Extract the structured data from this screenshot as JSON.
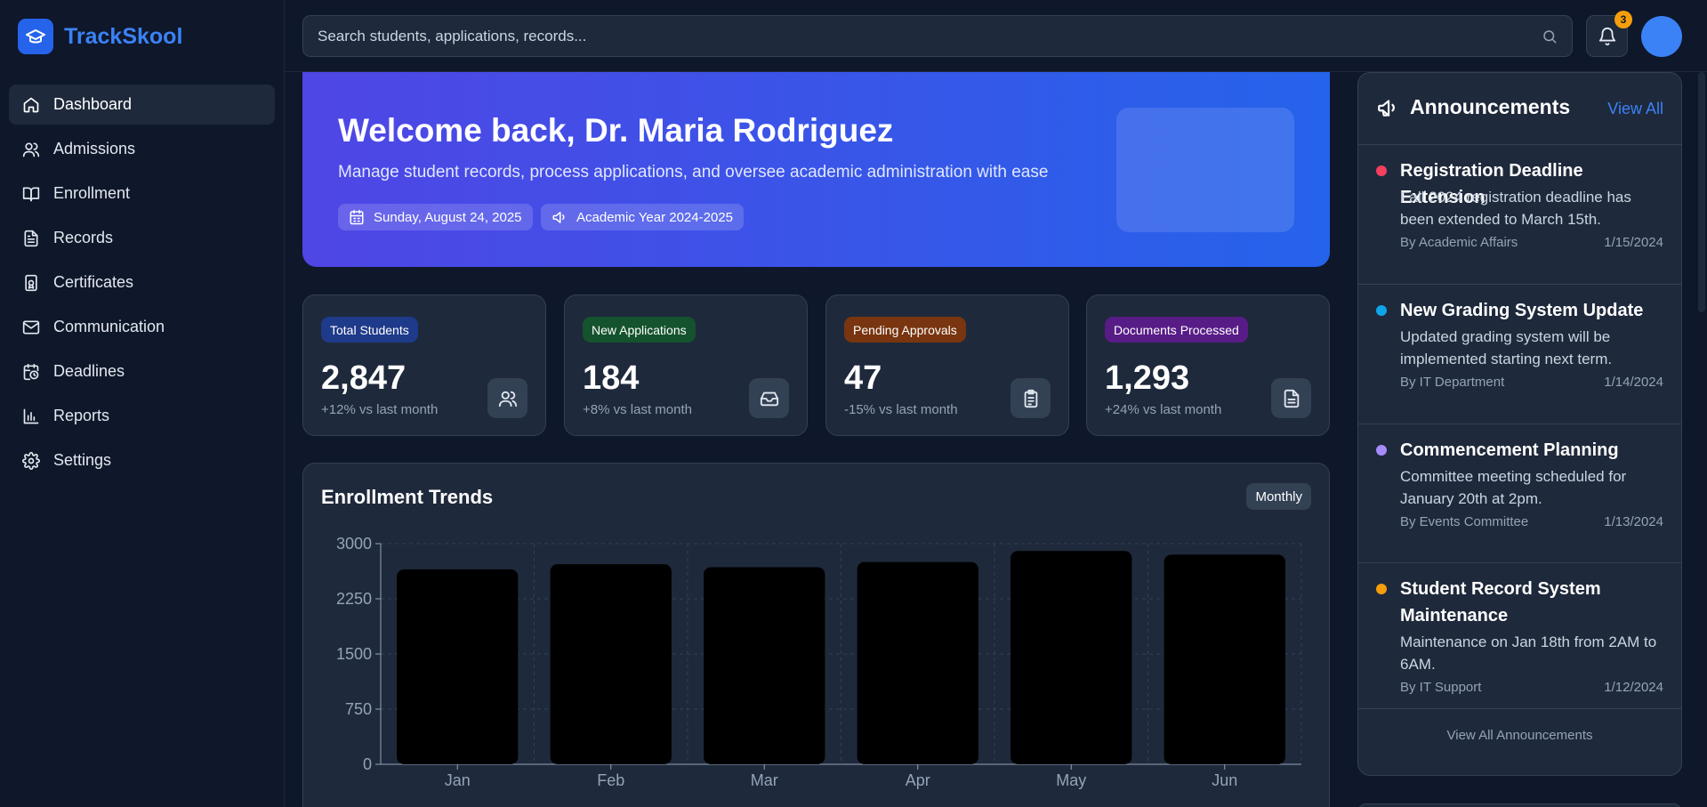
{
  "app": {
    "name": "TrackSkool"
  },
  "sidebar": {
    "items": [
      {
        "label": "Dashboard",
        "icon": "home-icon"
      },
      {
        "label": "Admissions",
        "icon": "users-icon"
      },
      {
        "label": "Enrollment",
        "icon": "book-open-icon"
      },
      {
        "label": "Records",
        "icon": "file-text-icon"
      },
      {
        "label": "Certificates",
        "icon": "certificate-icon"
      },
      {
        "label": "Communication",
        "icon": "mail-icon"
      },
      {
        "label": "Deadlines",
        "icon": "calendar-clock-icon"
      },
      {
        "label": "Reports",
        "icon": "bar-chart-icon"
      },
      {
        "label": "Settings",
        "icon": "gear-icon"
      }
    ],
    "active": "Dashboard"
  },
  "topbar": {
    "search_placeholder": "Search students, applications, records...",
    "notification_count": "3"
  },
  "hero": {
    "title": "Welcome back, Dr. Maria Rodriguez",
    "subtitle": "Manage student records, process applications, and oversee academic administration with ease",
    "date": "Sunday, August 24, 2025",
    "academic_year": "Academic Year 2024-2025"
  },
  "stats": [
    {
      "label": "Total Students",
      "value": "2,847",
      "change": "+12% vs last month",
      "label_bg": "#1e3a8a",
      "icon": "users-icon"
    },
    {
      "label": "New Applications",
      "value": "184",
      "change": "+8% vs last month",
      "label_bg": "#14532d",
      "icon": "inbox-icon"
    },
    {
      "label": "Pending Approvals",
      "value": "47",
      "change": "-15% vs last month",
      "label_bg": "#78350f",
      "icon": "clipboard-icon"
    },
    {
      "label": "Documents Processed",
      "value": "1,293",
      "change": "+24% vs last month",
      "label_bg": "#581c87",
      "icon": "document-icon"
    }
  ],
  "chart": {
    "title": "Enrollment Trends",
    "period": "Monthly"
  },
  "chart_data": {
    "type": "bar",
    "categories": [
      "Jan",
      "Feb",
      "Mar",
      "Apr",
      "May",
      "Jun"
    ],
    "values": [
      2650,
      2720,
      2680,
      2750,
      2900,
      2850
    ],
    "ylim": [
      0,
      3000
    ],
    "yticks": [
      "0",
      "750",
      "1500",
      "2250",
      "3000"
    ],
    "grid": true,
    "bar_color": "#000000"
  },
  "announcements": {
    "title": "Announcements",
    "view_all": "View All",
    "footer": "View All Announcements",
    "items": [
      {
        "title": "Registration Deadline Extension",
        "body": "Fall 2024 registration deadline has been extended to March 15th.",
        "by": "By Academic Affairs",
        "date": "1/15/2024",
        "color": "#f43f5e"
      },
      {
        "title": "New Grading System Update",
        "body": "Updated grading system will be implemented starting next term.",
        "by": "By IT Department",
        "date": "1/14/2024",
        "color": "#0ea5e9"
      },
      {
        "title": "Commencement Planning",
        "body": "Committee meeting scheduled for January 20th at 2pm.",
        "by": "By Events Committee",
        "date": "1/13/2024",
        "color": "#a78bfa"
      },
      {
        "title": "Student Record System Maintenance",
        "body": "Maintenance on Jan 18th from 2AM to 6AM.",
        "by": "By IT Support",
        "date": "1/12/2024",
        "color": "#f59e0b"
      }
    ]
  }
}
